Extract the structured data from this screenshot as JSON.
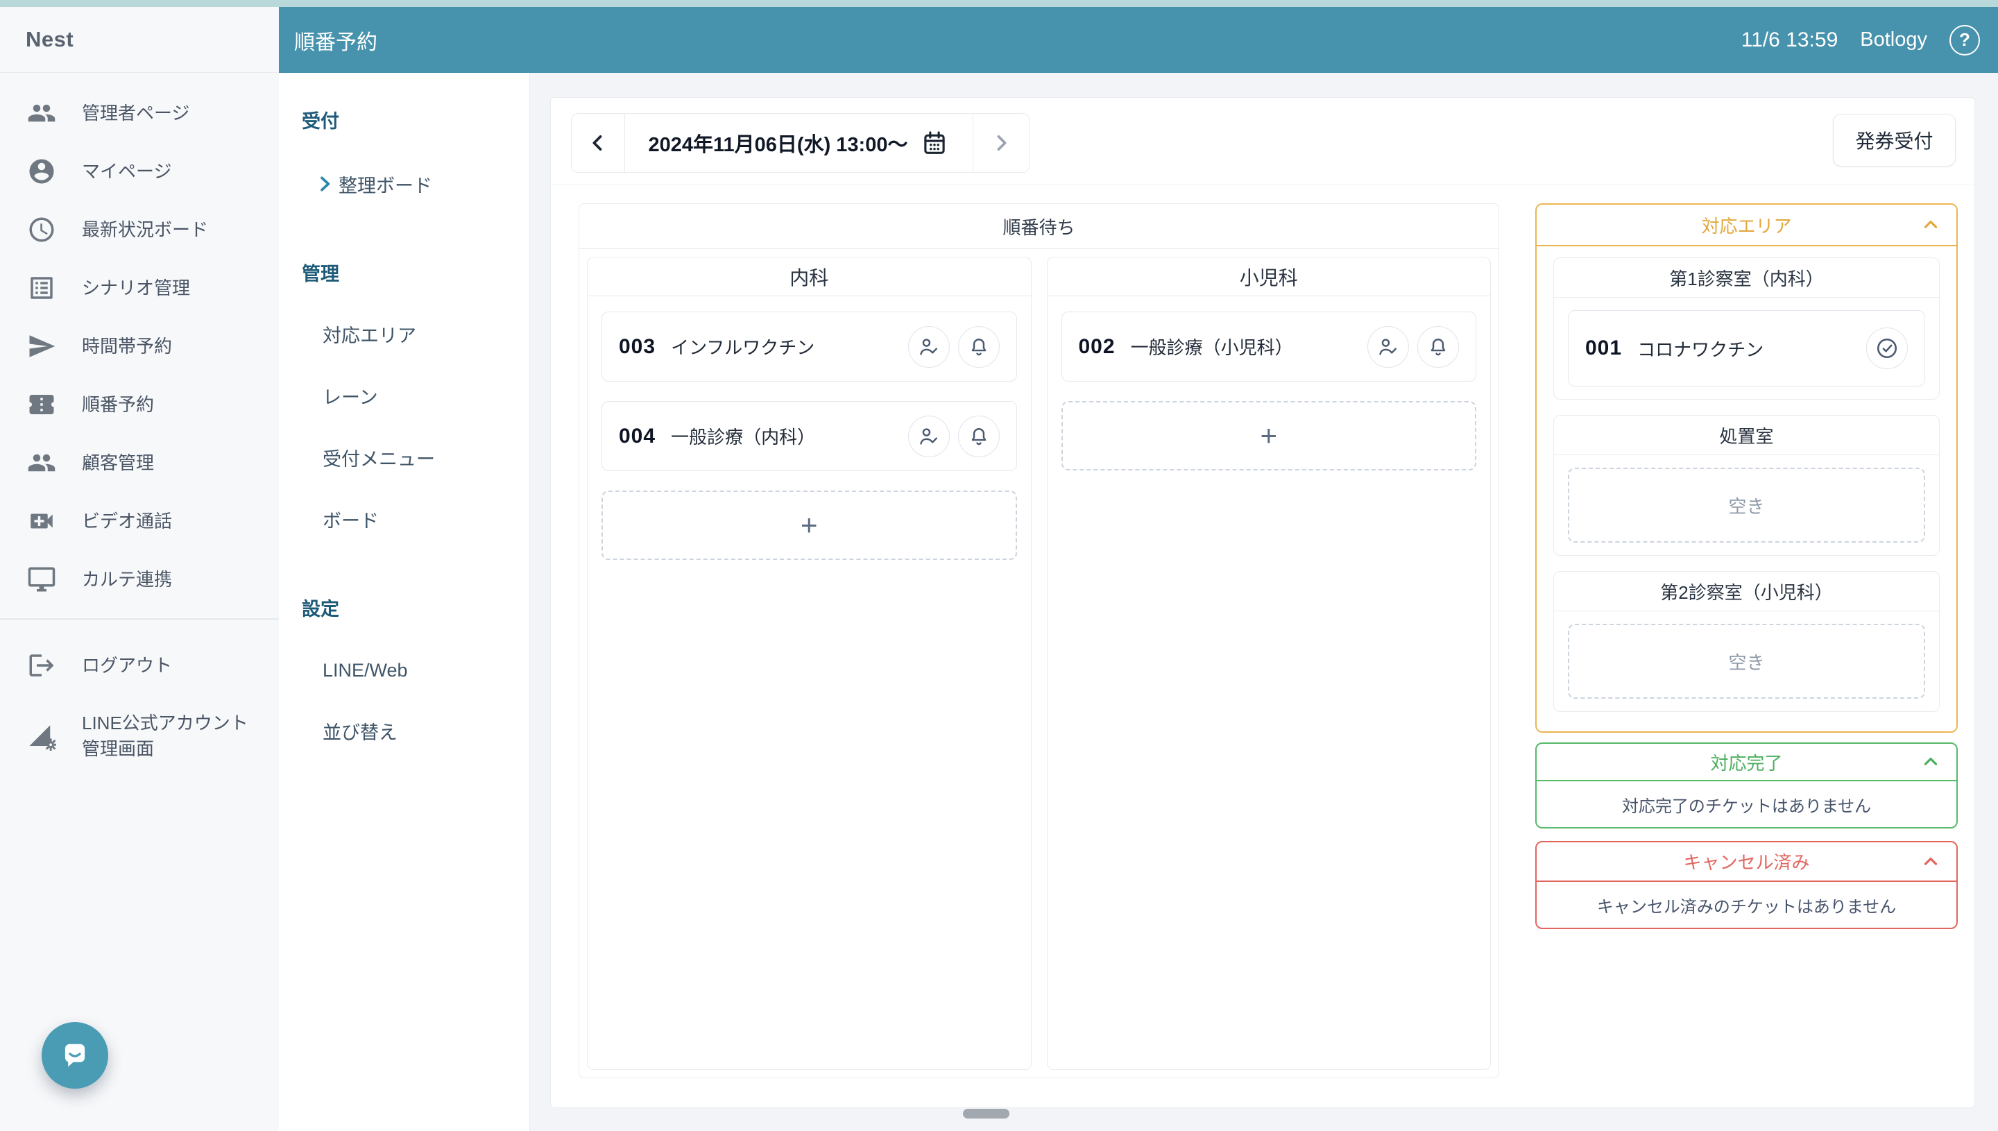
{
  "colors": {
    "header_teal": "#4792ac",
    "panel_amber": "#ecb54f",
    "amber_text": "#e2a83d",
    "panel_green": "#57b96a",
    "green_text": "#4cae5f",
    "panel_red": "#e2655e",
    "chat_teal": "#4a9cb5"
  },
  "brand": {
    "logo": "Nest"
  },
  "header": {
    "app_title": "順番予約",
    "clock": "11/6 13:59",
    "account": "Botlogy",
    "help_label": "?"
  },
  "sidebar": {
    "items": [
      {
        "label": "管理者ページ",
        "icon": "people-icon"
      },
      {
        "label": "マイページ",
        "icon": "account-circle-icon"
      },
      {
        "label": "最新状況ボード",
        "icon": "clock-icon"
      },
      {
        "label": "シナリオ管理",
        "icon": "list-icon"
      },
      {
        "label": "時間帯予約",
        "icon": "send-icon"
      },
      {
        "label": "順番予約",
        "icon": "ticket-icon"
      },
      {
        "label": "顧客管理",
        "icon": "people-icon"
      },
      {
        "label": "ビデオ通話",
        "icon": "video-icon"
      },
      {
        "label": "カルテ連携",
        "icon": "monitor-icon"
      }
    ],
    "footer_items": [
      {
        "label": "ログアウト",
        "icon": "logout-icon"
      },
      {
        "label": "LINE公式アカウント管理画面",
        "icon": "line-account-icon"
      }
    ]
  },
  "subnav": {
    "sections": [
      {
        "title": "受付",
        "items": [
          {
            "label": "整理ボード"
          }
        ]
      },
      {
        "title": "管理",
        "items": [
          {
            "label": "対応エリア"
          },
          {
            "label": "レーン"
          },
          {
            "label": "受付メニュー"
          },
          {
            "label": "ボード"
          }
        ]
      },
      {
        "title": "設定",
        "items": [
          {
            "label": "LINE/Web"
          },
          {
            "label": "並び替え"
          }
        ]
      }
    ]
  },
  "toolbar": {
    "date_label": "2024年11月06日(水) 13:00〜",
    "ticket_button": "発券受付"
  },
  "board": {
    "title": "順番待ち",
    "add_label": "+",
    "columns": [
      {
        "name": "内科",
        "tickets": [
          {
            "number": "003",
            "label": "インフルワクチン"
          },
          {
            "number": "004",
            "label": "一般診療（内科）"
          }
        ]
      },
      {
        "name": "小児科",
        "tickets": [
          {
            "number": "002",
            "label": "一般診療（小児科）"
          }
        ]
      }
    ]
  },
  "area_panel": {
    "title": "対応エリア",
    "rooms": [
      {
        "name": "第1診察室（内科）",
        "ticket": {
          "number": "001",
          "label": "コロナワクチン"
        }
      },
      {
        "name": "処置室",
        "empty_label": "空き"
      },
      {
        "name": "第2診察室（小児科）",
        "empty_label": "空き"
      }
    ]
  },
  "done_panel": {
    "title": "対応完了",
    "empty_message": "対応完了のチケットはありません"
  },
  "cancel_panel": {
    "title": "キャンセル済み",
    "empty_message": "キャンセル済みのチケットはありません"
  }
}
